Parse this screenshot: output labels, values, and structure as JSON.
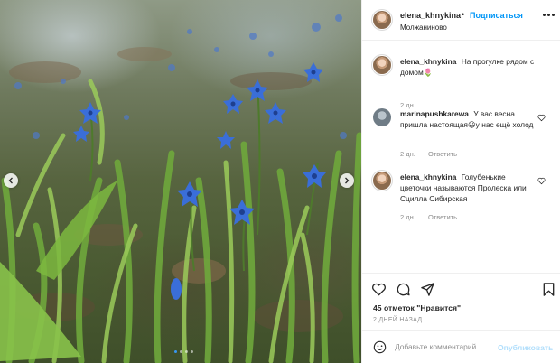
{
  "post": {
    "username": "elena_khnykina",
    "bullet": "•",
    "follow_label": "Подписаться",
    "location": "Молжаниново",
    "more_icon": "more-horizontal-icon"
  },
  "comments": [
    {
      "username": "elena_khnykina",
      "text": "На прогулке рядом с домом🌷",
      "time": "2 дн.",
      "reply_label": ""
    },
    {
      "username": "marinapushkarewa",
      "text": "У вас весна пришла настоящая😃у нас ещё холод",
      "time": "2 дн.",
      "reply_label": "Ответить"
    },
    {
      "username": "elena_khnykina",
      "text": "Голубенькие цветочки называются Пролеска или Сцилла Сибирская",
      "time": "2 дн.",
      "reply_label": "Ответить"
    }
  ],
  "actions": {
    "icons": [
      "heart-icon",
      "comment-icon",
      "share-icon",
      "bookmark-icon"
    ],
    "likes_count": "45 отметок",
    "likes_suffix": "\"Нравится\"",
    "timestamp": "2 ДНЕЙ НАЗАД"
  },
  "add_comment": {
    "placeholder": "Добавьте комментарий...",
    "publish_label": "Опубликовать"
  },
  "carousel": {
    "slide_count": 4,
    "active_index": 0
  },
  "colors": {
    "link_blue": "#0095f6",
    "publish_disabled": "#b2dffc",
    "text": "#262626",
    "muted": "#8e8e8e",
    "flower_blue": "#3a6ed8"
  }
}
